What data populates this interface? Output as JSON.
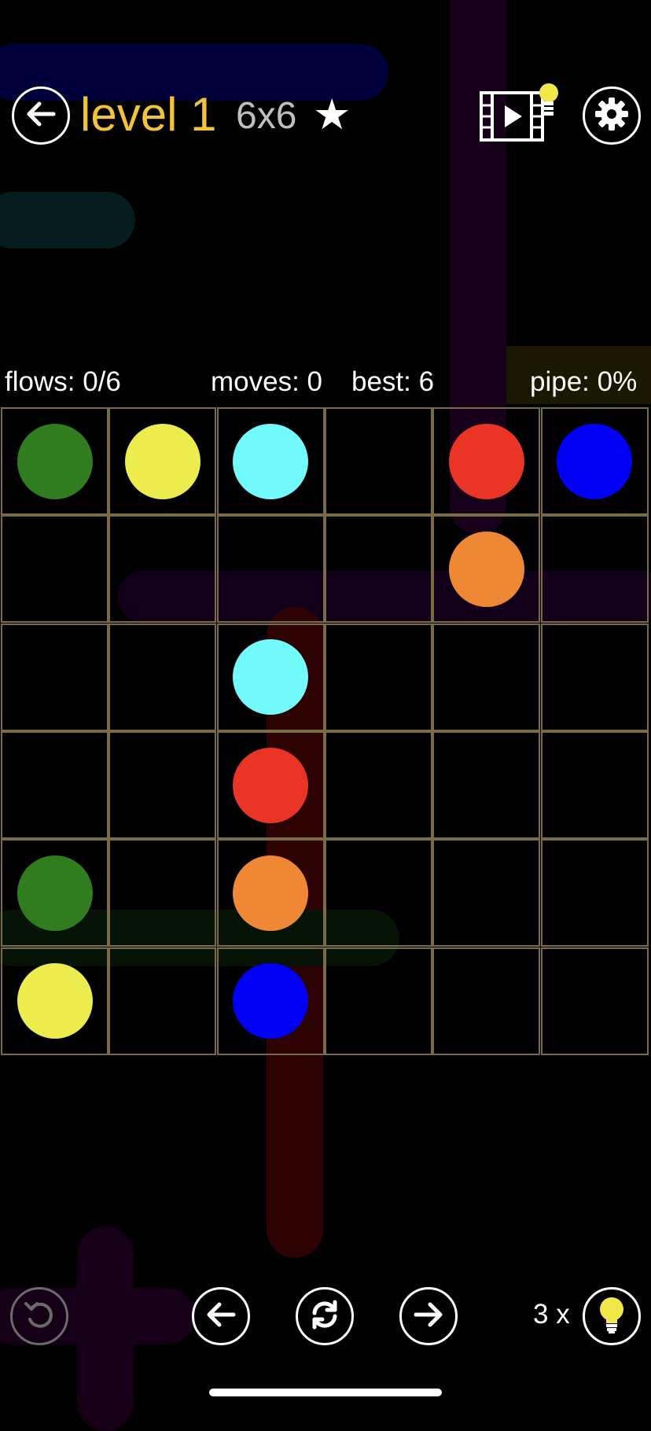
{
  "header": {
    "level_title": "level 1",
    "grid_size": "6x6",
    "star": "★",
    "back_icon": "arrow-left-icon",
    "video_hint_icon": "video-hint-icon",
    "settings_icon": "gear-icon"
  },
  "stats": {
    "flows": "flows: 0/6",
    "moves": "moves: 0",
    "best": "best: 6",
    "pipe": "pipe: 0%"
  },
  "board": {
    "rows": 6,
    "cols": 6,
    "grid_color": "#7a6b42",
    "dots": [
      {
        "row": 0,
        "col": 0,
        "color": "#2f7d1f",
        "name": "green"
      },
      {
        "row": 0,
        "col": 1,
        "color": "#ecec4f",
        "name": "yellow"
      },
      {
        "row": 0,
        "col": 2,
        "color": "#72fafb",
        "name": "cyan"
      },
      {
        "row": 0,
        "col": 4,
        "color": "#e93426",
        "name": "red"
      },
      {
        "row": 0,
        "col": 5,
        "color": "#0000f5",
        "name": "blue"
      },
      {
        "row": 1,
        "col": 4,
        "color": "#ef8834",
        "name": "orange"
      },
      {
        "row": 2,
        "col": 2,
        "color": "#72fafb",
        "name": "cyan"
      },
      {
        "row": 3,
        "col": 2,
        "color": "#e93426",
        "name": "red"
      },
      {
        "row": 4,
        "col": 0,
        "color": "#2f7d1f",
        "name": "green"
      },
      {
        "row": 4,
        "col": 2,
        "color": "#ef8834",
        "name": "orange"
      },
      {
        "row": 5,
        "col": 0,
        "color": "#ecec4f",
        "name": "yellow"
      },
      {
        "row": 5,
        "col": 2,
        "color": "#0000f5",
        "name": "blue"
      }
    ]
  },
  "footer": {
    "hint_count": "3 x",
    "undo_icon": "undo-icon",
    "prev_icon": "arrow-left-icon",
    "restart_icon": "restart-icon",
    "next_icon": "arrow-right-icon",
    "hint_icon": "lightbulb-icon"
  }
}
